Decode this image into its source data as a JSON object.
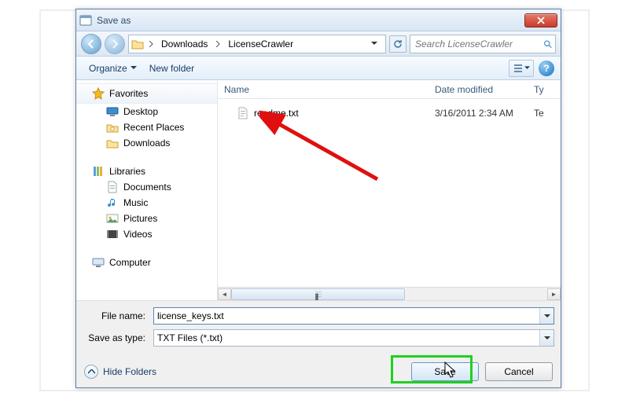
{
  "titlebar": {
    "title": "Save as"
  },
  "breadcrumb": {
    "seg1": "Downloads",
    "seg2": "LicenseCrawler"
  },
  "search": {
    "placeholder": "Search LicenseCrawler"
  },
  "toolbar": {
    "organize": "Organize",
    "new_folder": "New folder",
    "help_glyph": "?"
  },
  "sidebar": {
    "favorites": "Favorites",
    "fav_items": [
      "Desktop",
      "Recent Places",
      "Downloads"
    ],
    "libraries": "Libraries",
    "lib_items": [
      "Documents",
      "Music",
      "Pictures",
      "Videos"
    ],
    "computer": "Computer"
  },
  "columns": {
    "name": "Name",
    "date": "Date modified",
    "type": "Ty"
  },
  "files": [
    {
      "name": "readme.txt",
      "date": "3/16/2011 2:34 AM",
      "type": "Te"
    }
  ],
  "form": {
    "filename_label": "File name:",
    "filename_value": "license_keys.txt",
    "savetype_label": "Save as type:",
    "savetype_value": "TXT Files (*.txt)"
  },
  "footer": {
    "hide_folders": "Hide Folders",
    "save": "Save",
    "cancel": "Cancel"
  },
  "scroll_grip": "ǁ"
}
